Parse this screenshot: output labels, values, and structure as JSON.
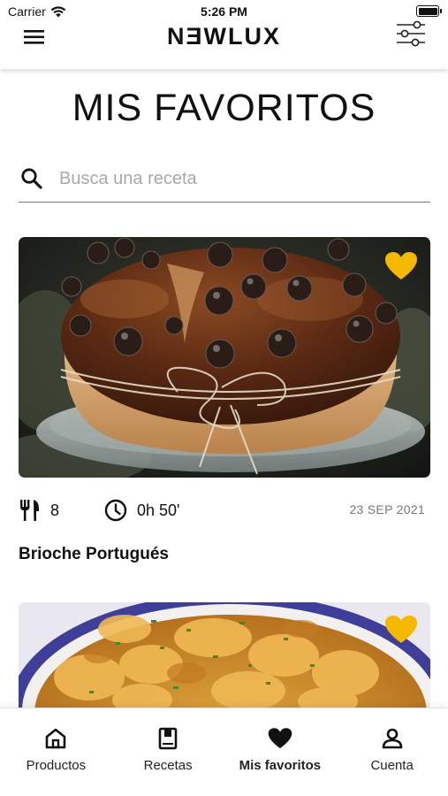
{
  "status_bar": {
    "carrier": "Carrier",
    "time": "5:26 PM"
  },
  "header": {
    "brand": "NƎWLUX",
    "menu_icon": "hamburger-menu-icon",
    "filter_icon": "sliders-filter-icon"
  },
  "page_title": "MIS FAVORITOS",
  "search": {
    "placeholder": "Busca una receta",
    "value": "",
    "icon": "search-icon"
  },
  "recipes": [
    {
      "name": "Brioche Portugués",
      "servings": "8",
      "duration": "0h 50'",
      "date": "23 SEP 2021",
      "favorite": true,
      "image": "brioche-with-chocolate-chips-photo"
    },
    {
      "name": "",
      "favorite": true,
      "image": "stewed-chicken-dish-photo"
    }
  ],
  "tab_bar": {
    "items": [
      {
        "label": "Productos",
        "icon": "home-icon"
      },
      {
        "label": "Recetas",
        "icon": "book-icon"
      },
      {
        "label": "Mis favoritos",
        "icon": "heart-icon",
        "active": true
      },
      {
        "label": "Cuenta",
        "icon": "user-icon"
      }
    ]
  },
  "colors": {
    "accent_favorite": "#F5B800",
    "text": "#111111",
    "muted": "#777777"
  }
}
